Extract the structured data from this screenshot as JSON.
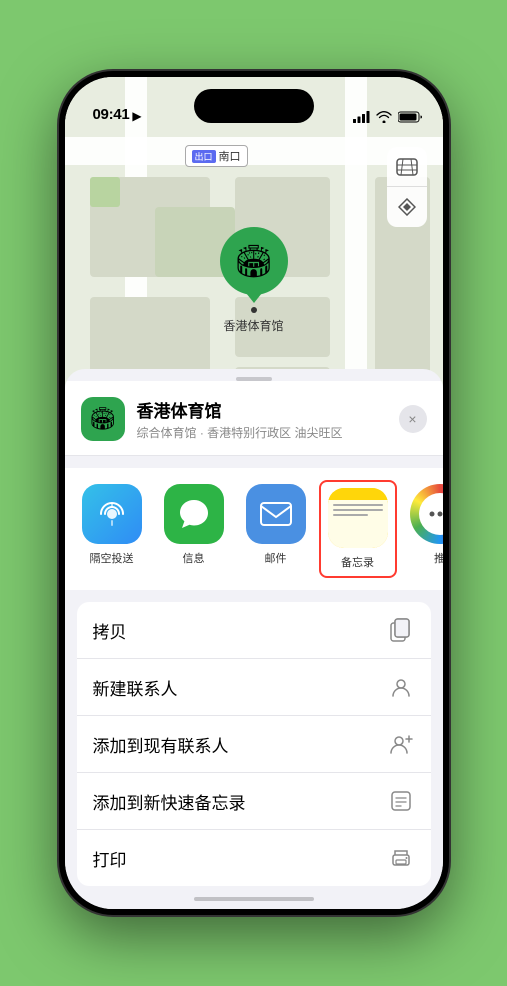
{
  "statusBar": {
    "time": "09:41",
    "locationIcon": "▶"
  },
  "mapControls": {
    "mapTypeIcon": "🗺",
    "locationIcon": "➤"
  },
  "mapLabel": {
    "badge": "出口",
    "text": "南口"
  },
  "locationPin": {
    "label": "香港体育馆"
  },
  "placeHeader": {
    "name": "香港体育馆",
    "subtitle": "综合体育馆 · 香港特别行政区 油尖旺区",
    "closeLabel": "×"
  },
  "shareItems": [
    {
      "id": "airdrop",
      "label": "隔空投送"
    },
    {
      "id": "messages",
      "label": "信息"
    },
    {
      "id": "mail",
      "label": "邮件"
    },
    {
      "id": "notes",
      "label": "备忘录"
    },
    {
      "id": "more",
      "label": "推"
    }
  ],
  "actionItems": [
    {
      "id": "copy",
      "label": "拷贝",
      "icon": "⎘"
    },
    {
      "id": "new-contact",
      "label": "新建联系人",
      "icon": "👤"
    },
    {
      "id": "add-existing",
      "label": "添加到现有联系人",
      "icon": "👤+"
    },
    {
      "id": "add-quicknote",
      "label": "添加到新快速备忘录",
      "icon": "📝"
    },
    {
      "id": "print",
      "label": "打印",
      "icon": "🖨"
    }
  ]
}
